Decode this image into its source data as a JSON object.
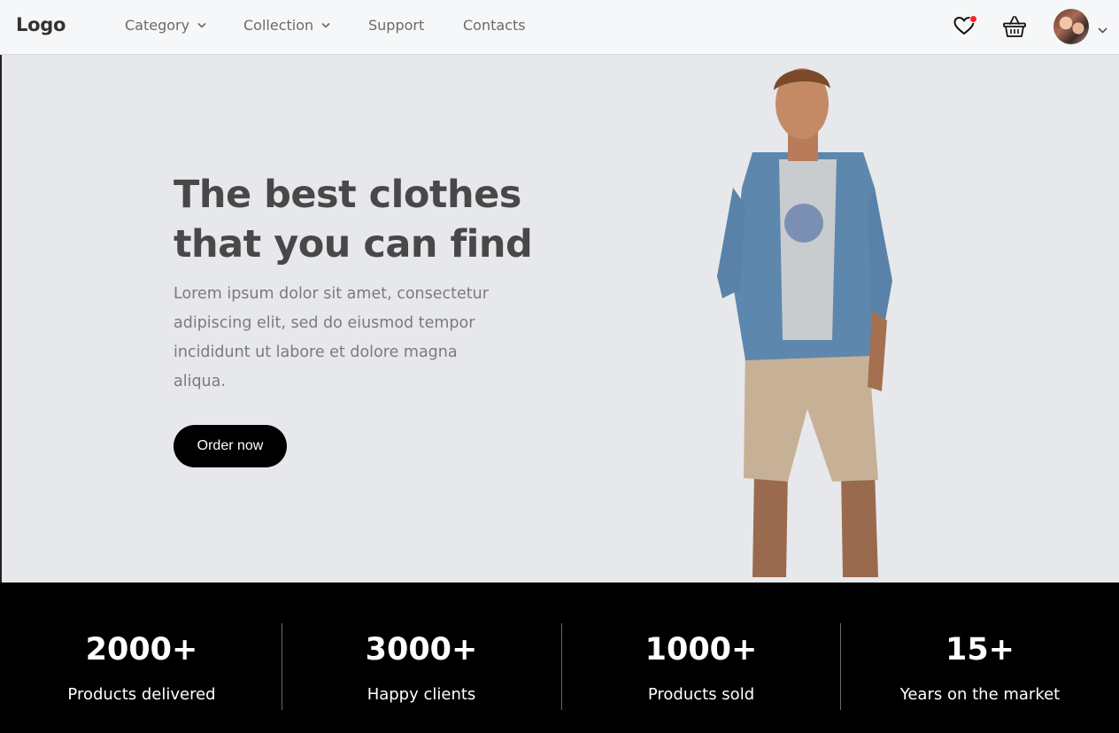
{
  "header": {
    "logo": "Logo",
    "nav": [
      {
        "label": "Category",
        "has_dropdown": true
      },
      {
        "label": "Collection",
        "has_dropdown": true
      },
      {
        "label": "Support",
        "has_dropdown": false
      },
      {
        "label": "Contacts",
        "has_dropdown": false
      }
    ],
    "icons": [
      "heart-icon",
      "basket-icon",
      "avatar",
      "chevron-down-icon"
    ],
    "notification_color": "#ff1f1f"
  },
  "hero": {
    "title": "The best clothes that you can find",
    "text": "Lorem ipsum dolor sit amet, consectetur adipiscing elit, sed do eiusmod tempor incididunt ut labore et dolore magna aliqua.",
    "cta_label": "Order now",
    "background": "#e7e8ec"
  },
  "stats": [
    {
      "value": "2000+",
      "label": "Products delivered"
    },
    {
      "value": "3000+",
      "label": "Happy clients"
    },
    {
      "value": "1000+",
      "label": "Products sold"
    },
    {
      "value": "15+",
      "label": "Years on the market"
    }
  ]
}
